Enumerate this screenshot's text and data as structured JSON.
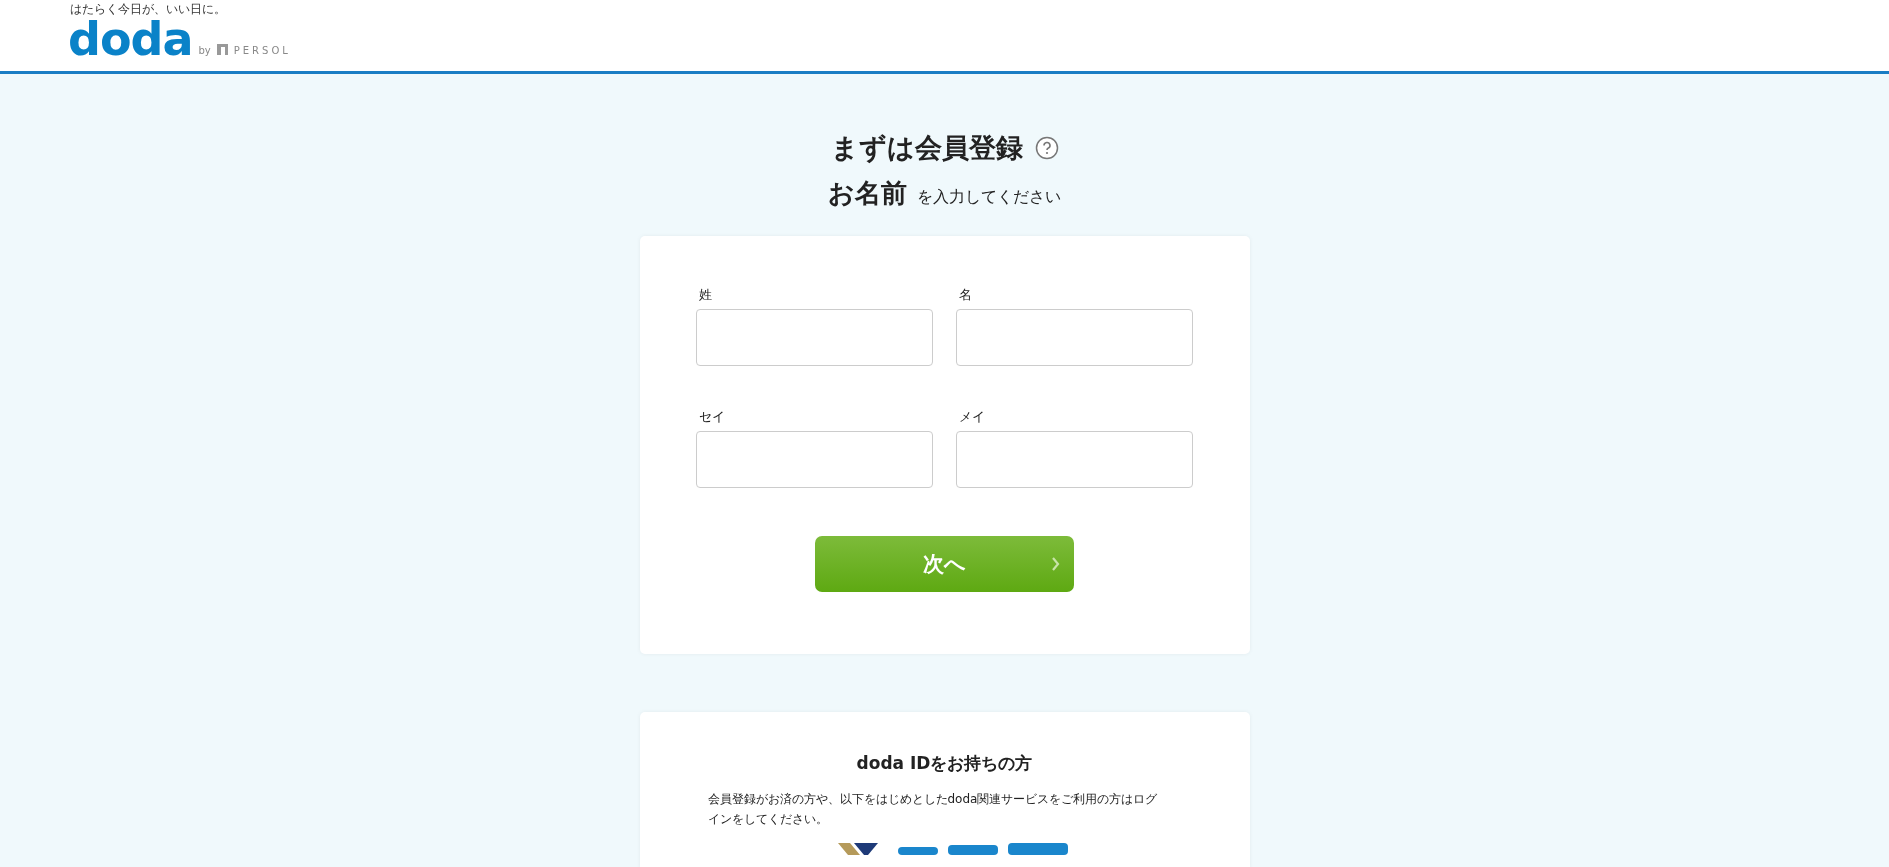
{
  "header": {
    "tagline": "はたらく今日が、いい日に。",
    "logo": "doda",
    "by": "by",
    "brand": "PERSOL"
  },
  "heading": {
    "title": "まずは会員登録",
    "subtitle_bold": "お名前",
    "subtitle_rest": "を入力してください"
  },
  "fields": [
    {
      "label": "姓"
    },
    {
      "label": "名"
    },
    {
      "label": "セイ"
    },
    {
      "label": "メイ"
    }
  ],
  "next_button": {
    "label": "次へ"
  },
  "login": {
    "title": "doda IDをお持ちの方",
    "text": "会員登録がお済の方や、以下をはじめとしたdoda関連サービスをご利用の方はログインをしてください。"
  }
}
